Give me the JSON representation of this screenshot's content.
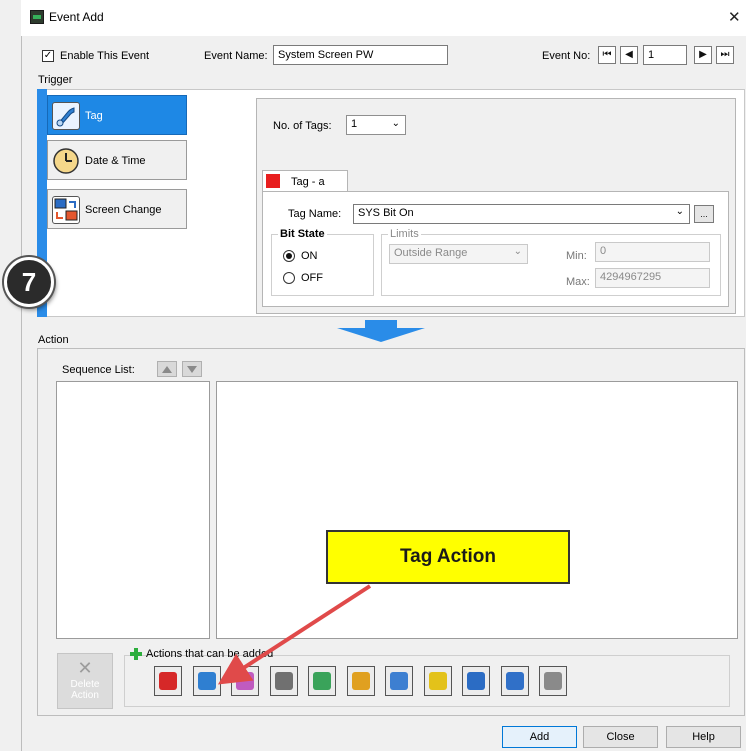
{
  "window": {
    "title": "Event Add",
    "close_glyph": "✕",
    "icon": "app-icon"
  },
  "top": {
    "enable_label": "Enable This Event",
    "enable_checked": true,
    "event_name_label": "Event Name:",
    "event_name_value": "System Screen PW",
    "event_no_label": "Event No:",
    "event_no_value": "1",
    "nav": {
      "first": "⏮",
      "prev": "◀",
      "next": "▶",
      "last": "⏭"
    }
  },
  "trigger": {
    "section_label": "Trigger",
    "types": [
      {
        "label": "Tag",
        "icon": "tag-icon",
        "active": true
      },
      {
        "label": "Date & Time",
        "icon": "clock-icon",
        "active": false
      },
      {
        "label": "Screen Change",
        "icon": "screen-change-icon",
        "active": false
      }
    ],
    "num_tags_label": "No. of Tags:",
    "num_tags_value": "1",
    "tag_tab_label": "Tag - a",
    "tag_tab_color": "#e81e1e",
    "tag_name_label": "Tag Name:",
    "tag_name_value": "SYS Bit On",
    "browse_label": "...",
    "bit_state_label": "Bit State",
    "on_label": "ON",
    "off_label": "OFF",
    "bit_state_selected": "ON",
    "limits_label": "Limits",
    "limits_mode": "Outside Range",
    "min_label": "Min:",
    "min_value": "0",
    "max_label": "Max:",
    "max_value": "4294967295"
  },
  "action": {
    "section_label": "Action",
    "sequence_list_label": "Sequence List:",
    "delete_label_1": "Delete",
    "delete_label_2": "Action",
    "delete_icon": "✕",
    "actions_label": "Actions that can be added",
    "add_icon": "plus-icon",
    "buttons": [
      {
        "name": "alarm-action-icon",
        "color": "#d62828"
      },
      {
        "name": "tag-action-icon",
        "color": "#2f7fd1"
      },
      {
        "name": "tag-copy-action-icon",
        "color": "#c05bc0"
      },
      {
        "name": "sound-action-icon",
        "color": "#707070"
      },
      {
        "name": "screen-capture-action-icon",
        "color": "#3aa35a"
      },
      {
        "name": "email-action-icon",
        "color": "#e0a020"
      },
      {
        "name": "folder-action-icon",
        "color": "#3d7fd1"
      },
      {
        "name": "flash-action-icon",
        "color": "#e3c21a"
      },
      {
        "name": "screen-change-action-icon",
        "color": "#2b6cc4"
      },
      {
        "name": "popup-action-icon",
        "color": "#3070c8"
      },
      {
        "name": "calculator-action-icon",
        "color": "#8a8a8a"
      }
    ]
  },
  "footer": {
    "add_label": "Add",
    "close_label": "Close",
    "help_label": "Help"
  },
  "annotations": {
    "step_number": "7",
    "callout_text": "Tag Action",
    "arrow_color": "#e04a4a",
    "flow_arrow_color": "#2a8ce8"
  }
}
